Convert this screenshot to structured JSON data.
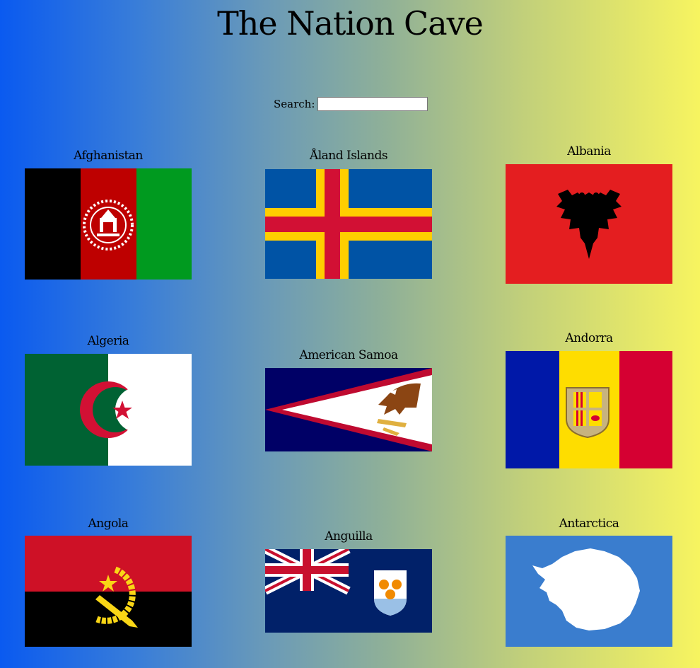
{
  "title": "The Nation Cave",
  "search": {
    "label": "Search:",
    "value": "",
    "placeholder": ""
  },
  "flags": [
    {
      "name": "Afghanistan"
    },
    {
      "name": "Åland Islands"
    },
    {
      "name": "Albania"
    },
    {
      "name": "Algeria"
    },
    {
      "name": "American Samoa"
    },
    {
      "name": "Andorra"
    },
    {
      "name": "Angola"
    },
    {
      "name": "Anguilla"
    },
    {
      "name": "Antarctica"
    }
  ]
}
